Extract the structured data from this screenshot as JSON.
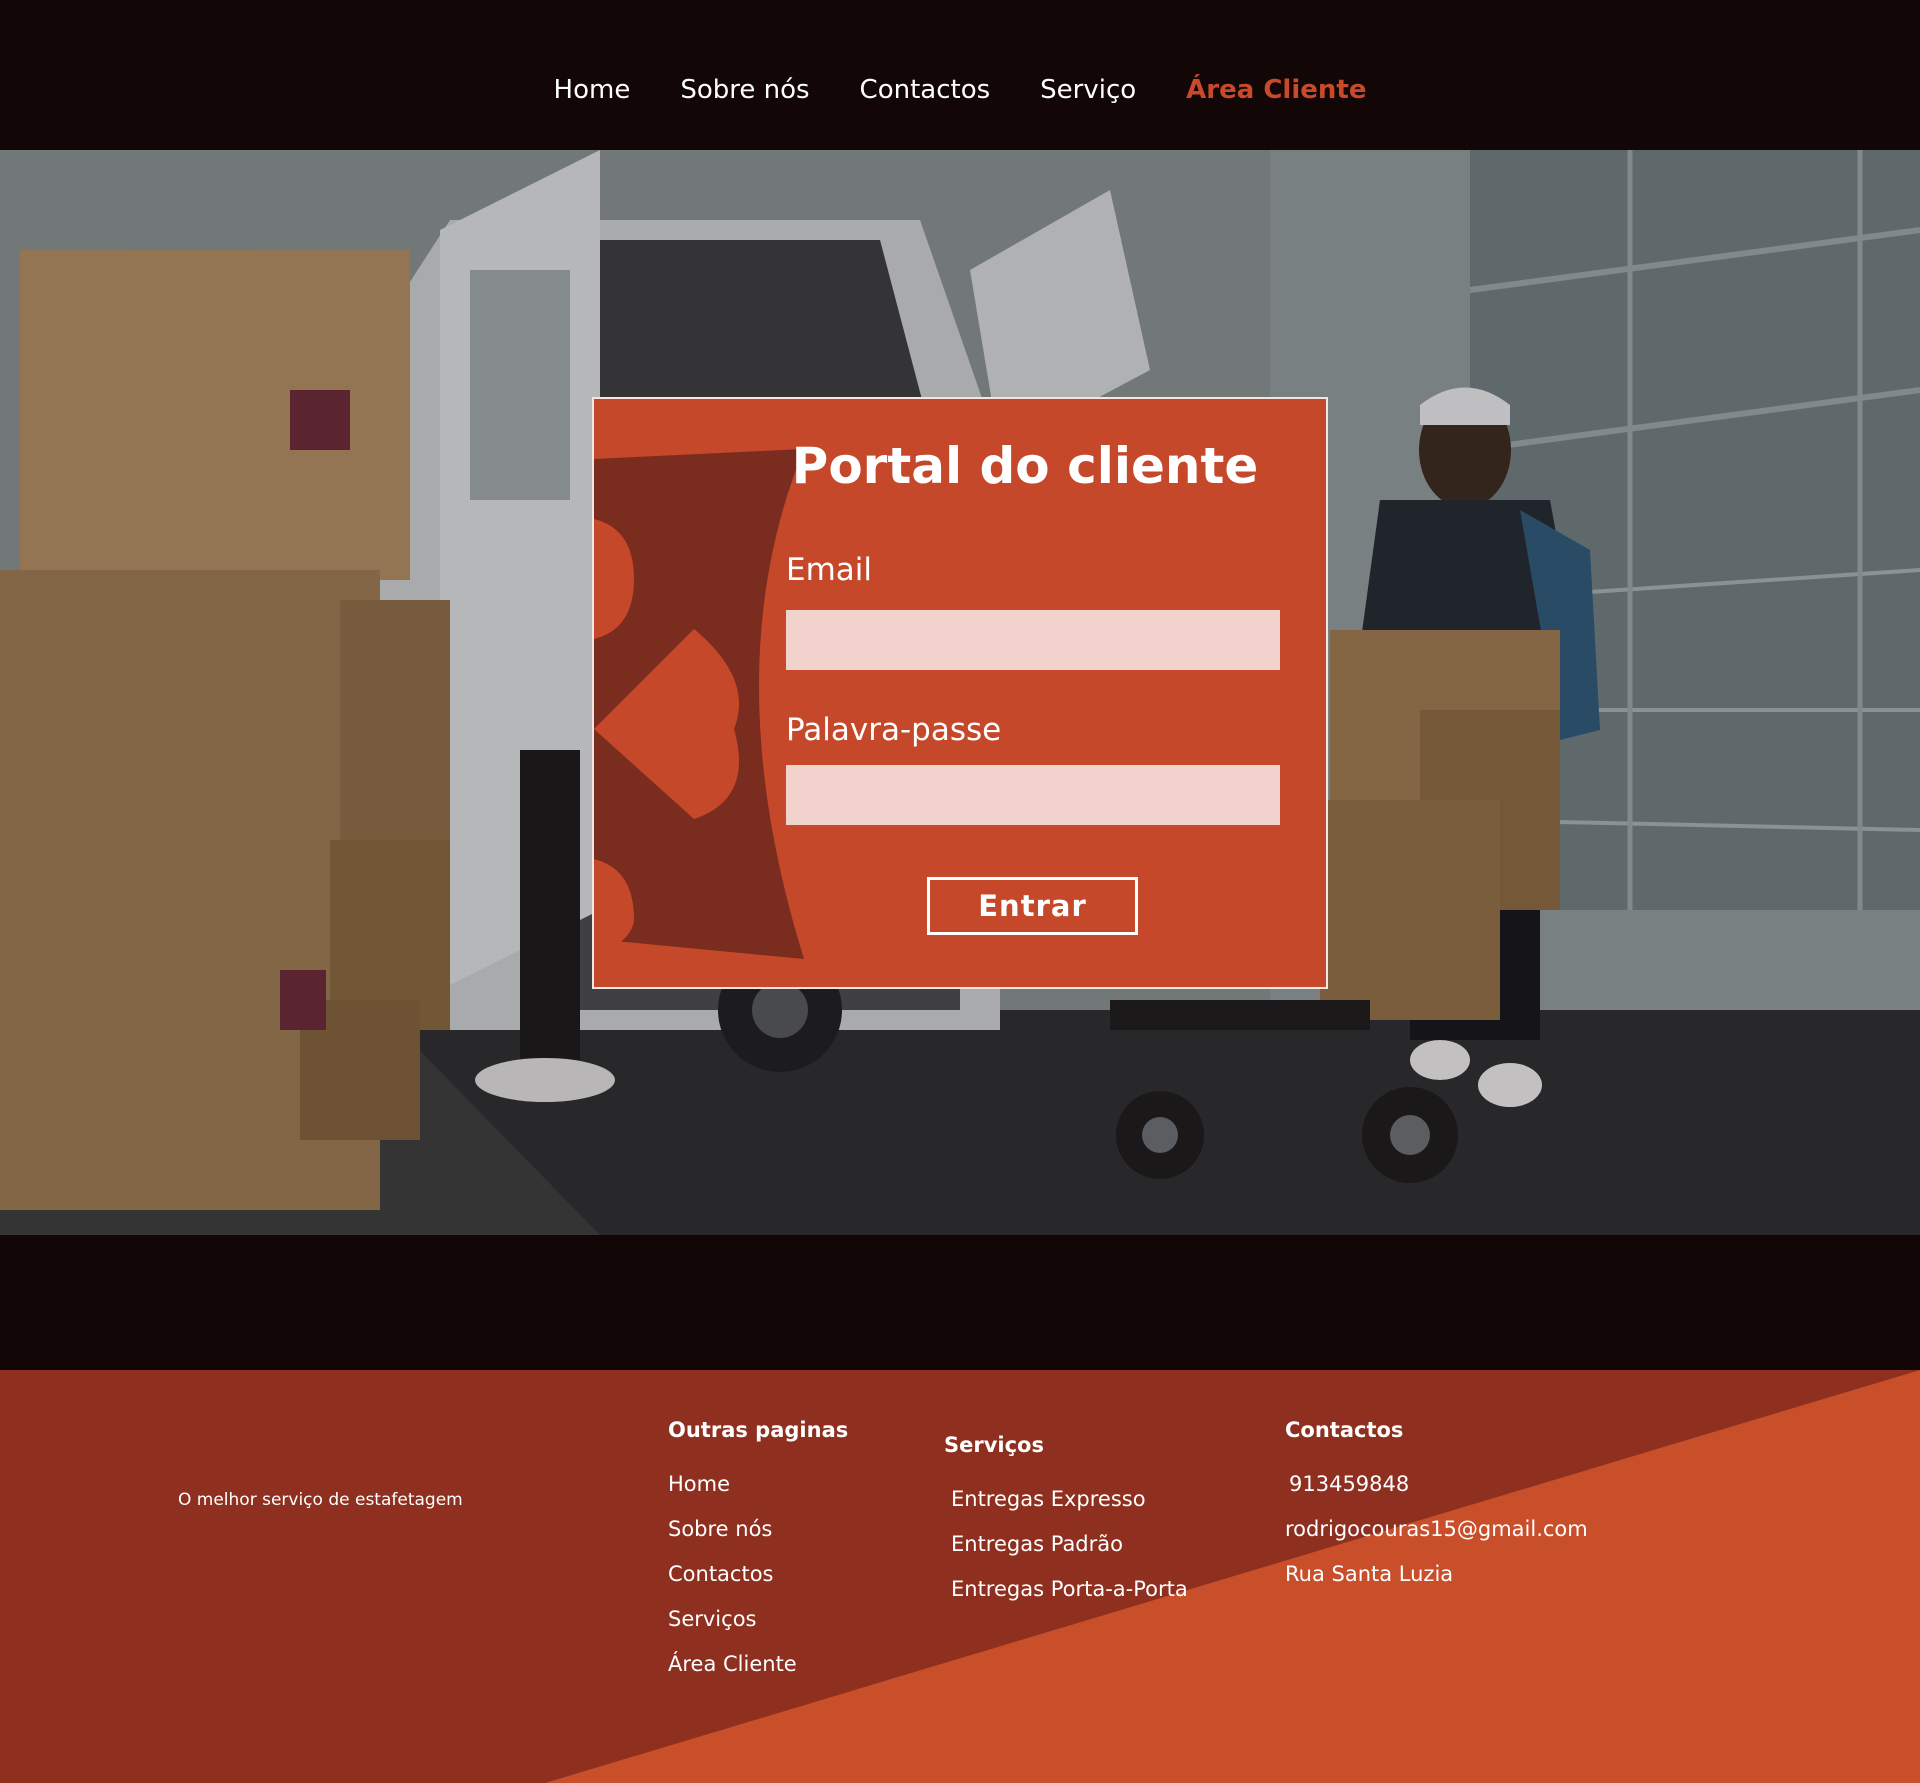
{
  "nav": {
    "links": [
      {
        "label": "Home"
      },
      {
        "label": "Sobre nós"
      },
      {
        "label": "Contactos"
      },
      {
        "label": "Serviço"
      },
      {
        "label": "Área Cliente"
      }
    ]
  },
  "login": {
    "title": "Portal do cliente",
    "email_label": "Email",
    "password_label": "Palavra-passe",
    "email_value": "",
    "password_value": "",
    "submit_label": "Entrar"
  },
  "footer": {
    "tagline": "O melhor serviço de estafetagem",
    "pages": {
      "title": "Outras paginas",
      "items": [
        "Home",
        "Sobre nós",
        "Contactos",
        "Serviços",
        "Área Cliente"
      ]
    },
    "services": {
      "title": "Serviços",
      "items": [
        "Entregas Expresso",
        "Entregas Padrão",
        "Entregas Porta-a-Porta"
      ]
    },
    "contacts": {
      "title": "Contactos",
      "items": [
        "913459848",
        "rodrigocouras15@gmail.com",
        "Rua Santa Luzia"
      ]
    }
  },
  "colors": {
    "accent": "#c84a2b",
    "card": "#c6482a",
    "footer_dark": "#8e2f1f",
    "footer_light": "#c94e2a",
    "background": "#130606"
  }
}
